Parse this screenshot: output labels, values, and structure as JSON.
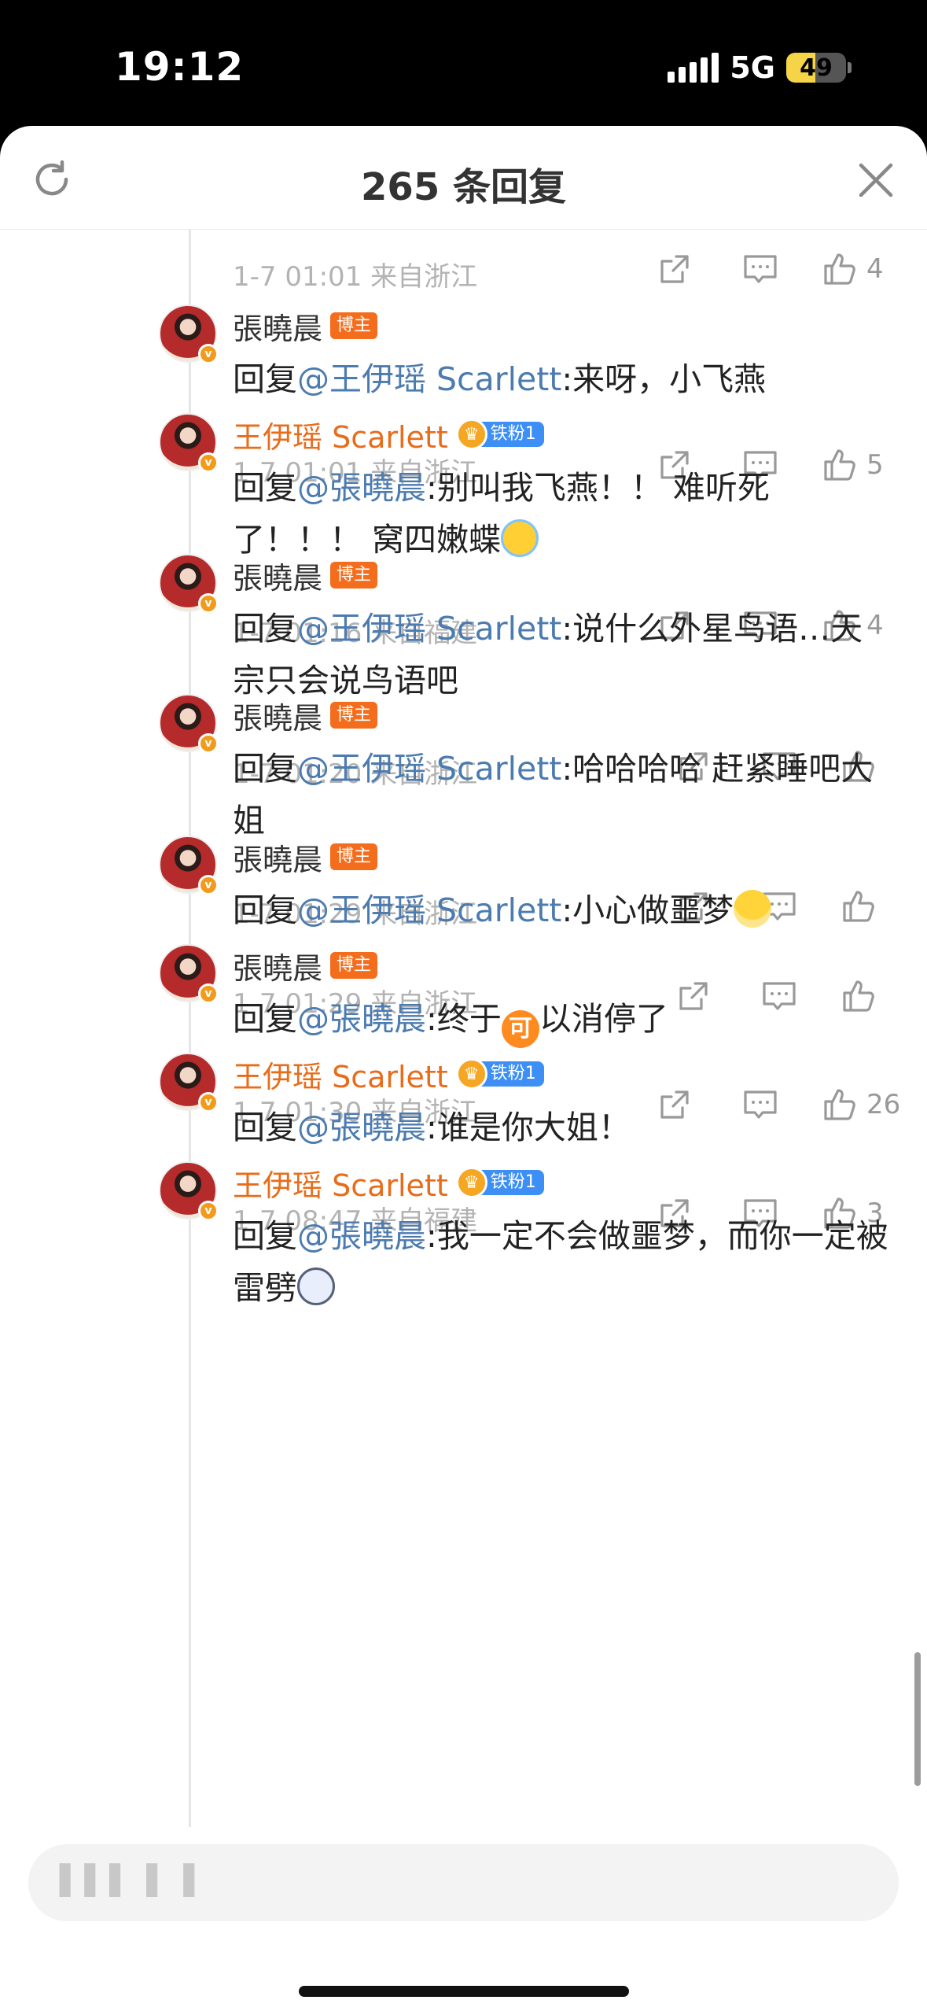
{
  "status_bar": {
    "time": "19:12",
    "network": "5G",
    "battery": "49",
    "battery_level": 0.49
  },
  "header": {
    "title": "265 条回复",
    "refresh_icon": "refresh-icon",
    "close_icon": "close-icon"
  },
  "top_meta": {
    "text": "1-7 01:01  来自浙江",
    "likes": "4"
  },
  "comments": [
    {
      "user": "張曉晨",
      "tag": "博主",
      "tag_type": "host",
      "reply_prefix": "回复",
      "mention": "@王伊瑶 Scarlett",
      "body": ":来呀，小飞燕",
      "emoji": "",
      "meta": "1-7 01:01  来自浙江",
      "likes": "5"
    },
    {
      "user": "王伊瑶 Scarlett",
      "tag": "铁粉1",
      "tag_type": "fan",
      "reply_prefix": "回复",
      "mention": "@張曉晨",
      "body": ":别叫我飞燕！！ 难听死了！！！ 窝四嫩蝶",
      "emoji": "laugh-cry-emoji",
      "meta": "1-7 01:16  来自福建",
      "likes": "4"
    },
    {
      "user": "張曉晨",
      "tag": "博主",
      "tag_type": "host",
      "reply_prefix": "回复",
      "mention": "@王伊瑶 Scarlett",
      "body": ":说什么外星鸟语…天宗只会说鸟语吧",
      "emoji": "",
      "meta": "1-7 01:20  来自浙江",
      "likes": ""
    },
    {
      "user": "張曉晨",
      "tag": "博主",
      "tag_type": "host",
      "reply_prefix": "回复",
      "mention": "@王伊瑶 Scarlett",
      "body": ":哈哈哈哈 赶紧睡吧大姐",
      "emoji": "",
      "meta": "1-7 01:29  来自浙江",
      "likes": ""
    },
    {
      "user": "張曉晨",
      "tag": "博主",
      "tag_type": "host",
      "reply_prefix": "回复",
      "mention": "@王伊瑶 Scarlett",
      "body": ":小心做噩梦",
      "emoji": "grin-emoji",
      "meta": "1-7 01:29  来自浙江",
      "likes": ""
    },
    {
      "user": "張曉晨",
      "tag": "博主",
      "tag_type": "host",
      "reply_prefix": "回复",
      "mention": "@張曉晨",
      "body": ":终于",
      "emoji_text": "可",
      "body_after": "以消停了",
      "meta": "1-7 01:30  来自浙江",
      "likes": "26"
    },
    {
      "user": "王伊瑶 Scarlett",
      "tag": "铁粉1",
      "tag_type": "fan",
      "reply_prefix": "回复",
      "mention": "@張曉晨",
      "body": ":谁是你大姐！",
      "emoji": "",
      "meta": "1-7 08:47  来自福建",
      "likes": "3"
    },
    {
      "user": "王伊瑶 Scarlett",
      "tag": "铁粉1",
      "tag_type": "fan",
      "reply_prefix": "回复",
      "mention": "@張曉晨",
      "body": ":我一定不会做噩梦，而你一定被雷劈",
      "emoji": "dizzy-emoji",
      "meta": "",
      "likes": ""
    }
  ],
  "bottom": {
    "input_placeholder": "▌▌▌ ▌ ▌"
  },
  "colors": {
    "accent_orange": "#e86c1a",
    "mention_blue": "#4c7bb0",
    "host_tag": "#f36d1c",
    "fan_tag": "#3d8ff5"
  }
}
